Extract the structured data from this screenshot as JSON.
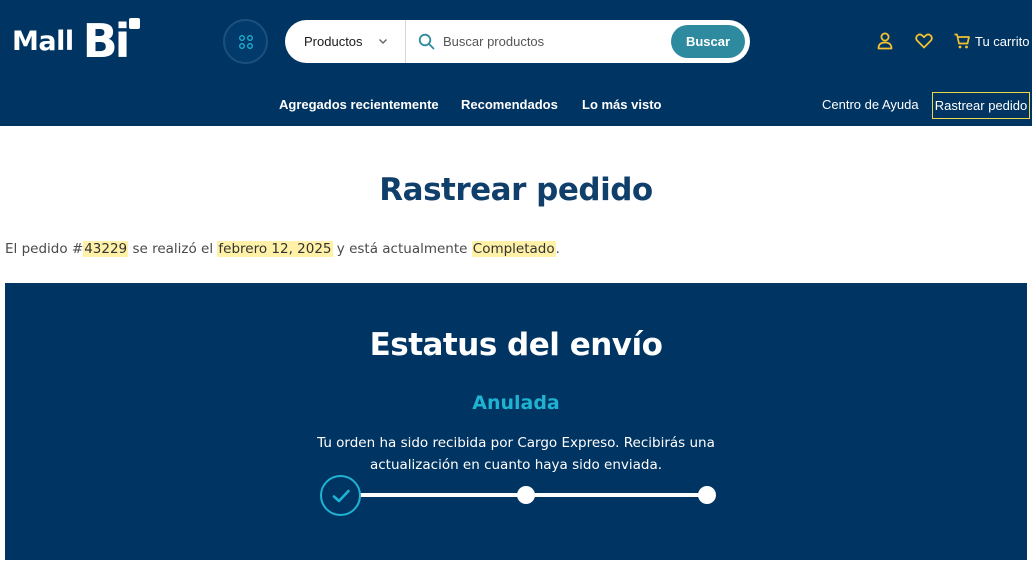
{
  "brand": {
    "mall": "Mall",
    "bi": "Bi"
  },
  "search": {
    "category_label": "Productos",
    "placeholder": "Buscar productos",
    "button_label": "Buscar"
  },
  "header_icons": [
    "user-icon",
    "heart-icon",
    "cart-icon"
  ],
  "cart": {
    "label": "Tu carrito"
  },
  "nav": {
    "items": [
      {
        "label": "Agregados recientemente"
      },
      {
        "label": "Recomendados"
      },
      {
        "label": "Lo más visto"
      }
    ],
    "help": "Centro de Ayuda",
    "track": "Rastrear pedido"
  },
  "page": {
    "title": "Rastrear pedido",
    "summary": {
      "prefix": "El pedido #",
      "order_number": "43229",
      "mid1": " se realizó el ",
      "date": "febrero 12, 2025",
      "mid2": " y está actualmente ",
      "status": "Completado",
      "suffix": "."
    }
  },
  "shipment": {
    "title": "Estatus del envío",
    "state": "Anulada",
    "message": "Tu orden ha sido recibida por Cargo Expreso. Recibirás una actualización en cuanto haya sido enviada.",
    "steps_total": 3,
    "steps_completed": 1
  },
  "colors": {
    "header_bg": "#003462",
    "accent_teal": "#2e8b9f",
    "status_cyan": "#1fb3d1",
    "icon_yellow": "#f2c230",
    "highlight": "#fff1a8",
    "track_border": "#e8d84a",
    "title_blue": "#103f6b"
  }
}
